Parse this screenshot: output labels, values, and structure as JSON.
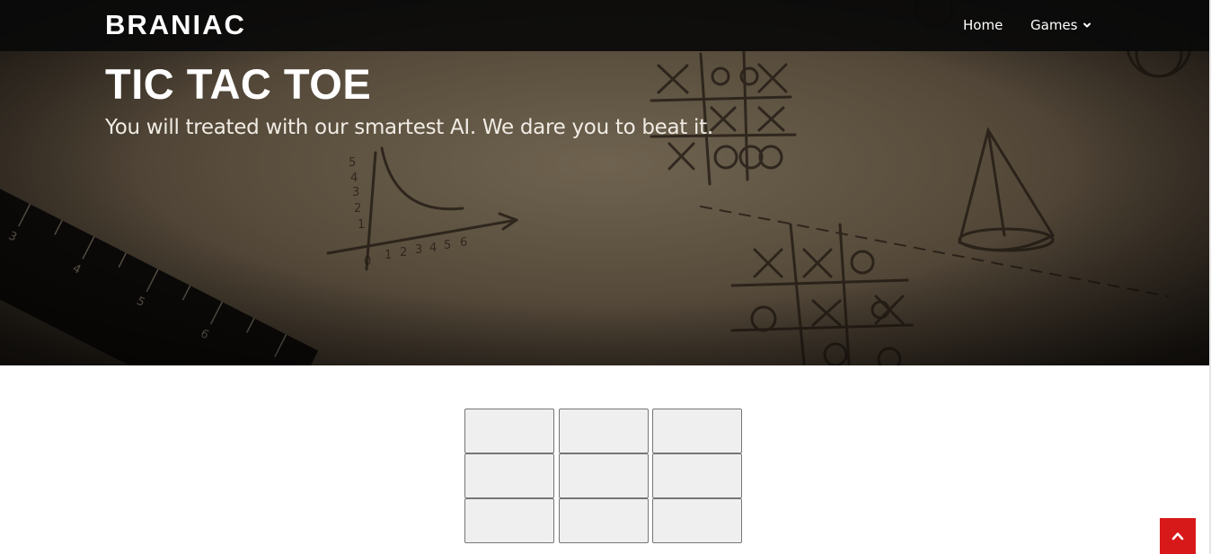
{
  "navbar": {
    "brand": "BRANIAC",
    "links": [
      {
        "label": "Home"
      },
      {
        "label": "Games",
        "icon": "chevron-down-icon"
      }
    ]
  },
  "hero": {
    "title": "TIC TAC TOE",
    "subtitle": "You will treated with our smartest AI. We dare you to beat it."
  },
  "board": {
    "cells": [
      "",
      "",
      "",
      "",
      "",
      "",
      "",
      "",
      ""
    ]
  },
  "back_to_top": {
    "icon": "chevron-up-icon"
  },
  "colors": {
    "navbar_bg": "#0a0a0a",
    "accent": "#d7191a",
    "cell_bg": "#efefef"
  }
}
